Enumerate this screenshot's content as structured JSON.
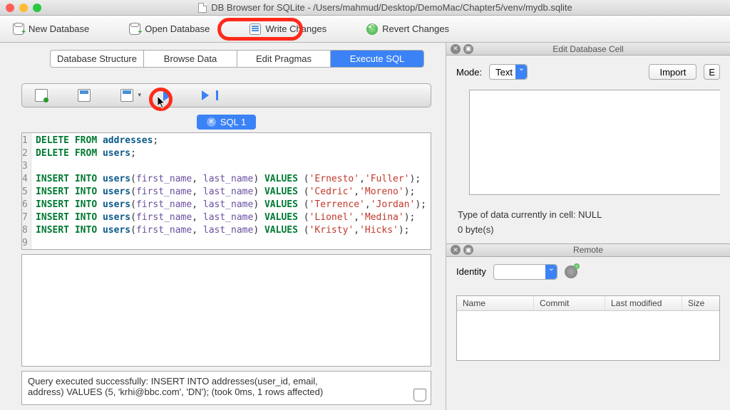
{
  "window": {
    "title": "DB Browser for SQLite - /Users/mahmud/Desktop/DemoMac/Chapter5/venv/mydb.sqlite"
  },
  "toolbar": {
    "new_db": "New Database",
    "open_db": "Open Database",
    "write_changes": "Write Changes",
    "revert_changes": "Revert Changes"
  },
  "tabs": {
    "structure": "Database Structure",
    "browse": "Browse Data",
    "pragmas": "Edit Pragmas",
    "execute": "Execute SQL"
  },
  "sql_tab": {
    "label": "SQL 1"
  },
  "sql_lines": [
    "1",
    "2",
    "3",
    "4",
    "5",
    "6",
    "7",
    "8",
    "9"
  ],
  "sql": {
    "l1_kw1": "DELETE FROM ",
    "l1_id": "addresses",
    "l1_end": ";",
    "l2_kw1": "DELETE FROM ",
    "l2_id": "users",
    "l2_end": ";",
    "ins": "INSERT INTO ",
    "usr": "users",
    "open": "(",
    "fn": "first_name",
    "comma": ", ",
    "ln": "last_name",
    "close": ") ",
    "vals": "VALUES ",
    "op": "(",
    "cm": ",",
    "cp": ");",
    "v4a": "'Ernesto'",
    "v4b": "'Fuller'",
    "v5a": "'Cedric'",
    "v5b": "'Moreno'",
    "v6a": "'Terrence'",
    "v6b": "'Jordan'",
    "v7a": "'Lionel'",
    "v7b": "'Medina'",
    "v8a": "'Kristy'",
    "v8b": "'Hicks'"
  },
  "status": {
    "line1": "Query executed successfully: INSERT INTO addresses(user_id, email,",
    "line2": "address) VALUES (5, 'krhi@bbc.com',    'DN'); (took 0ms, 1 rows affected)"
  },
  "edit_cell": {
    "panel_title": "Edit Database Cell",
    "mode_label": "Mode:",
    "mode_value": "Text",
    "import_btn": "Import",
    "type_info": "Type of data currently in cell: NULL",
    "size_info": "0 byte(s)"
  },
  "remote": {
    "panel_title": "Remote",
    "identity_label": "Identity",
    "cols": {
      "name": "Name",
      "commit": "Commit",
      "last_modified": "Last modified",
      "size": "Size"
    }
  }
}
